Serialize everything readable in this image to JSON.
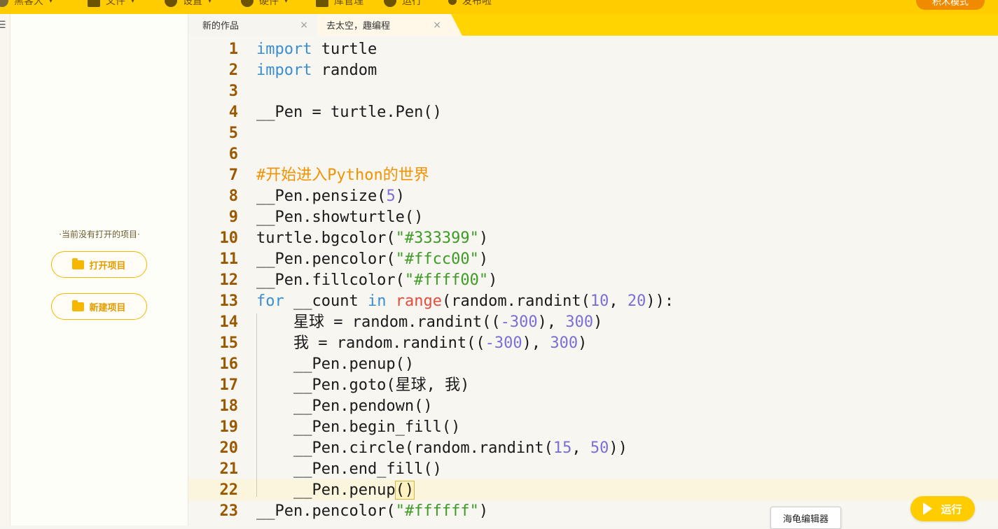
{
  "toolbar": {
    "items": [
      {
        "label": "黑客大",
        "icon": "avatar-icon"
      },
      {
        "label": "文件",
        "icon": "file-icon"
      },
      {
        "label": "设置",
        "icon": "gear-icon"
      },
      {
        "label": "硬件",
        "icon": "user-icon"
      },
      {
        "label": "库管理",
        "icon": "library-icon"
      },
      {
        "label": "运行",
        "icon": "run-icon"
      },
      {
        "label": "发布啦",
        "icon": "pin-icon"
      }
    ],
    "mode_label": "积木模式"
  },
  "tabs": [
    {
      "label": "新的作品",
      "close": "×"
    },
    {
      "label": "去太空，趣编程",
      "close": "×"
    }
  ],
  "sidebar": {
    "menu_icon": "☰",
    "empty_message": "·当前没有打开的项目·",
    "open_project": "打开项目",
    "new_project": "新建项目"
  },
  "editor": {
    "lines": [
      {
        "n": "1",
        "tokens": [
          {
            "t": "kw",
            "v": "import"
          },
          {
            "t": "",
            "v": " turtle"
          }
        ]
      },
      {
        "n": "2",
        "tokens": [
          {
            "t": "kw",
            "v": "import"
          },
          {
            "t": "",
            "v": " random"
          }
        ]
      },
      {
        "n": "3",
        "tokens": []
      },
      {
        "n": "4",
        "tokens": [
          {
            "t": "",
            "v": "__Pen = turtle.Pen()"
          }
        ]
      },
      {
        "n": "5",
        "tokens": []
      },
      {
        "n": "6",
        "tokens": []
      },
      {
        "n": "7",
        "tokens": [
          {
            "t": "cmt",
            "v": "#开始进入Python的世界"
          }
        ]
      },
      {
        "n": "8",
        "tokens": [
          {
            "t": "",
            "v": "__Pen.pensize("
          },
          {
            "t": "num",
            "v": "5"
          },
          {
            "t": "",
            "v": ")"
          }
        ]
      },
      {
        "n": "9",
        "tokens": [
          {
            "t": "",
            "v": "__Pen.showturtle()"
          }
        ]
      },
      {
        "n": "10",
        "tokens": [
          {
            "t": "",
            "v": "turtle.bgcolor("
          },
          {
            "t": "str",
            "v": "\"#333399\""
          },
          {
            "t": "",
            "v": ")"
          }
        ]
      },
      {
        "n": "11",
        "tokens": [
          {
            "t": "",
            "v": "__Pen.pencolor("
          },
          {
            "t": "str",
            "v": "\"#ffcc00\""
          },
          {
            "t": "",
            "v": ")"
          }
        ]
      },
      {
        "n": "12",
        "tokens": [
          {
            "t": "",
            "v": "__Pen.fillcolor("
          },
          {
            "t": "str",
            "v": "\"#ffff00\""
          },
          {
            "t": "",
            "v": ")"
          }
        ]
      },
      {
        "n": "13",
        "tokens": [
          {
            "t": "kw",
            "v": "for"
          },
          {
            "t": "",
            "v": " __count "
          },
          {
            "t": "kw",
            "v": "in"
          },
          {
            "t": "",
            "v": " "
          },
          {
            "t": "builtin",
            "v": "range"
          },
          {
            "t": "",
            "v": "(random.randint("
          },
          {
            "t": "num",
            "v": "10"
          },
          {
            "t": "",
            "v": ", "
          },
          {
            "t": "num",
            "v": "20"
          },
          {
            "t": "",
            "v": ")):"
          }
        ]
      },
      {
        "n": "14",
        "tokens": [
          {
            "t": "",
            "v": "    星球 = random.randint(("
          },
          {
            "t": "num",
            "v": "-300"
          },
          {
            "t": "",
            "v": "), "
          },
          {
            "t": "num",
            "v": "300"
          },
          {
            "t": "",
            "v": ")"
          }
        ]
      },
      {
        "n": "15",
        "tokens": [
          {
            "t": "",
            "v": "    我 = random.randint(("
          },
          {
            "t": "num",
            "v": "-300"
          },
          {
            "t": "",
            "v": "), "
          },
          {
            "t": "num",
            "v": "300"
          },
          {
            "t": "",
            "v": ")"
          }
        ]
      },
      {
        "n": "16",
        "tokens": [
          {
            "t": "",
            "v": "    __Pen.penup()"
          }
        ]
      },
      {
        "n": "17",
        "tokens": [
          {
            "t": "",
            "v": "    __Pen.goto(星球, 我)"
          }
        ]
      },
      {
        "n": "18",
        "tokens": [
          {
            "t": "",
            "v": "    __Pen.pendown()"
          }
        ]
      },
      {
        "n": "19",
        "tokens": [
          {
            "t": "",
            "v": "    __Pen.begin_fill()"
          }
        ]
      },
      {
        "n": "20",
        "tokens": [
          {
            "t": "",
            "v": "    __Pen.circle(random.randint("
          },
          {
            "t": "num",
            "v": "15"
          },
          {
            "t": "",
            "v": ", "
          },
          {
            "t": "num",
            "v": "50"
          },
          {
            "t": "",
            "v": "))"
          }
        ]
      },
      {
        "n": "21",
        "tokens": [
          {
            "t": "",
            "v": "    __Pen.end_fill()"
          }
        ]
      },
      {
        "n": "22",
        "tokens": [
          {
            "t": "",
            "v": "    __Pen.penup"
          },
          {
            "t": "bracket-hl",
            "v": "()"
          }
        ]
      },
      {
        "n": "23",
        "tokens": [
          {
            "t": "",
            "v": "__Pen.pencolor("
          },
          {
            "t": "str",
            "v": "\"#ffffff\""
          },
          {
            "t": "",
            "v": ")"
          }
        ]
      }
    ]
  },
  "footer": {
    "turtle_editor_label": "海龟编辑器",
    "run_label": "运行"
  },
  "colors": {
    "accent": "#ffcc00",
    "keyword": "#3b8ed4",
    "number": "#7b6fd6",
    "string": "#3d9b26",
    "comment": "#f39200",
    "builtin": "#e74c3c",
    "line_number": "#9a5800"
  }
}
